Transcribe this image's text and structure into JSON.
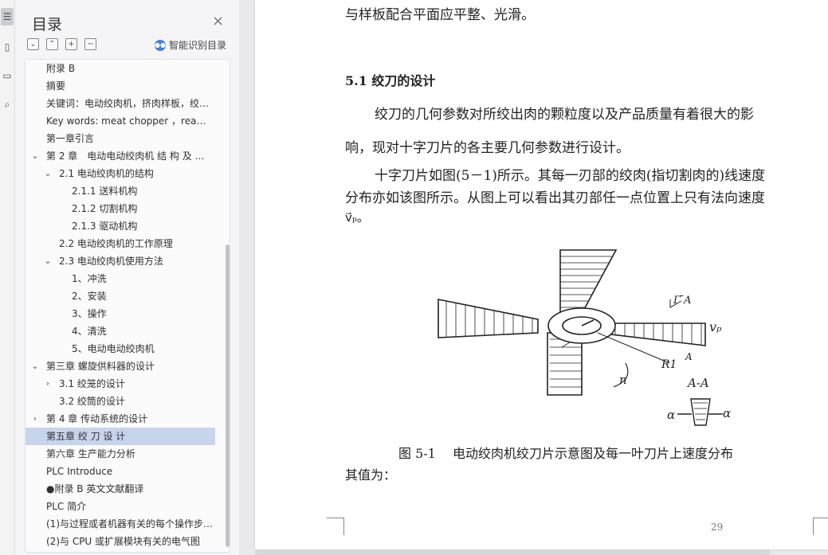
{
  "tool_strip": {
    "icons": [
      "toc-icon",
      "page-icon",
      "bookmark-icon",
      "search-icon"
    ]
  },
  "toc": {
    "title": "目录",
    "close_glyph": "×",
    "tools": [
      "⌄",
      "⌃",
      "+",
      "−"
    ],
    "smart_label": "智能识别目录",
    "items": [
      {
        "label": "附录 B",
        "level": 0,
        "chev": ""
      },
      {
        "label": "摘要",
        "level": 0,
        "chev": ""
      },
      {
        "label": "关键词：电动绞肉机，挤肉样板，绞刀，电动…",
        "level": 0,
        "chev": ""
      },
      {
        "label": "Key words: meat chopper ，reamer，motor…",
        "level": 0,
        "chev": ""
      },
      {
        "label": "第一章引言",
        "level": 0,
        "chev": ""
      },
      {
        "label": "第 2 章　电动电动绞肉机 结 构 及 …",
        "level": 0,
        "chev": "⌄"
      },
      {
        "label": "2.1 电动绞肉机的结构",
        "level": 1,
        "chev": "⌄"
      },
      {
        "label": "2.1.1 送料机构",
        "level": 2,
        "chev": ""
      },
      {
        "label": "2.1.2 切割机构",
        "level": 2,
        "chev": ""
      },
      {
        "label": "2.1.3 驱动机构",
        "level": 2,
        "chev": ""
      },
      {
        "label": "2.2 电动绞肉机的工作原理",
        "level": 1,
        "chev": ""
      },
      {
        "label": "2.3 电动绞肉机使用方法",
        "level": 1,
        "chev": "⌄"
      },
      {
        "label": "1、冲洗",
        "level": 2,
        "chev": ""
      },
      {
        "label": "2、安装",
        "level": 2,
        "chev": ""
      },
      {
        "label": "3、操作",
        "level": 2,
        "chev": ""
      },
      {
        "label": "4、清洗",
        "level": 2,
        "chev": ""
      },
      {
        "label": "5、电动电动绞肉机",
        "level": 2,
        "chev": ""
      },
      {
        "label": "第三章 螺旋供料器的设计",
        "level": 0,
        "chev": "⌄"
      },
      {
        "label": "3.1 绞笼的设计",
        "level": 1,
        "chev": "›"
      },
      {
        "label": "3.2 绞筒的设计",
        "level": 1,
        "chev": ""
      },
      {
        "label": "第 4 章 传动系统的设计",
        "level": 0,
        "chev": "›"
      },
      {
        "label": "第五章 绞 刀 设 计",
        "level": 0,
        "chev": "",
        "selected": true
      },
      {
        "label": "第六章 生产能力分析",
        "level": 0,
        "chev": ""
      },
      {
        "label": "PLC Introduce",
        "level": 0,
        "chev": ""
      },
      {
        "label": "●附录 B 英文文献翻译",
        "level": 0,
        "chev": ""
      },
      {
        "label": "PLC 简介",
        "level": 0,
        "chev": ""
      },
      {
        "label": "(1)与过程或者机器有关的每个操作步骤都…",
        "level": 0,
        "chev": ""
      },
      {
        "label": "(2)与 CPU 或扩展模块有关的电气图",
        "level": 0,
        "chev": ""
      }
    ]
  },
  "document": {
    "top_line": "与样板配合平面应平整、光滑。",
    "section_heading": "5.1 绞刀的设计",
    "para1_line1": "绞刀的几何参数对所绞出肉的颗粒度以及产品质量有着很大的影",
    "para1_line2": "响，现对十字刀片的各主要几何参数进行设计。",
    "para2_line1": "十字刀片如图(5－1)所示。其每一刃部的绞肉(指切割肉的)线速度",
    "para2_line2": "分布亦如该图所示。从图上可以看出其刃部任一点位置上只有法向速度",
    "para2_line3": "v⃗ₚ。",
    "figure_caption": "图 5-1　 电动绞肉机绞刀片示意图及每一叶刀片上速度分布",
    "after_caption": "其值为：",
    "page_number": "29",
    "figure_labels": {
      "vp": "vₚ",
      "r_section": "Γ ̄A",
      "r1": "R1",
      "a_small": "A",
      "n": "n",
      "section_aa": "A-A",
      "alpha_left": "α",
      "alpha_right": "α"
    }
  }
}
